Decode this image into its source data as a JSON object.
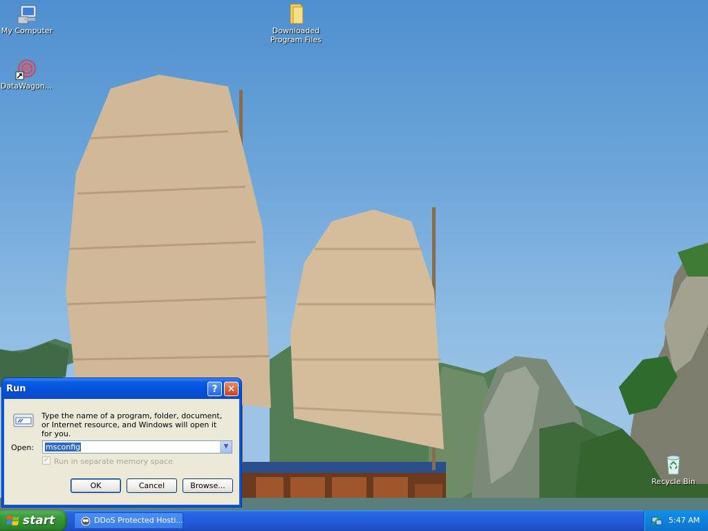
{
  "desktop": {
    "icons": [
      {
        "label": "My Computer",
        "icon": "my-computer-icon"
      },
      {
        "label": "DataWagon...",
        "icon": "datawagon-shortcut-icon"
      },
      {
        "label": "Downloaded Program Files",
        "icon": "folder-icon"
      },
      {
        "label": "Recycle Bin",
        "icon": "recycle-bin-icon"
      }
    ],
    "wallpaper": "junk boat with sails in Ha Long Bay"
  },
  "run_dialog": {
    "title": "Run",
    "help_button": "?",
    "close_button": "✕",
    "description": "Type the name of a program, folder, document, or Internet resource, and Windows will open it for you.",
    "open_label": "Open:",
    "open_value": "msconfig",
    "separate_memory_label": "Run in separate memory space",
    "separate_memory_checked": true,
    "ok_label": "OK",
    "cancel_label": "Cancel",
    "browse_label": "Browse..."
  },
  "taskbar": {
    "start_label": "start",
    "items": [
      {
        "label": "DDoS Protected Hosti...",
        "icon": "browser-icon"
      }
    ],
    "clock": "5:47 AM",
    "tray_icons": [
      "network-icon"
    ]
  },
  "colors": {
    "taskbar_blue": "#245ddb",
    "start_green": "#3c9c3c",
    "dialog_face": "#ece9d8",
    "title_blue": "#0450d9",
    "selection_blue": "#316ac5"
  }
}
